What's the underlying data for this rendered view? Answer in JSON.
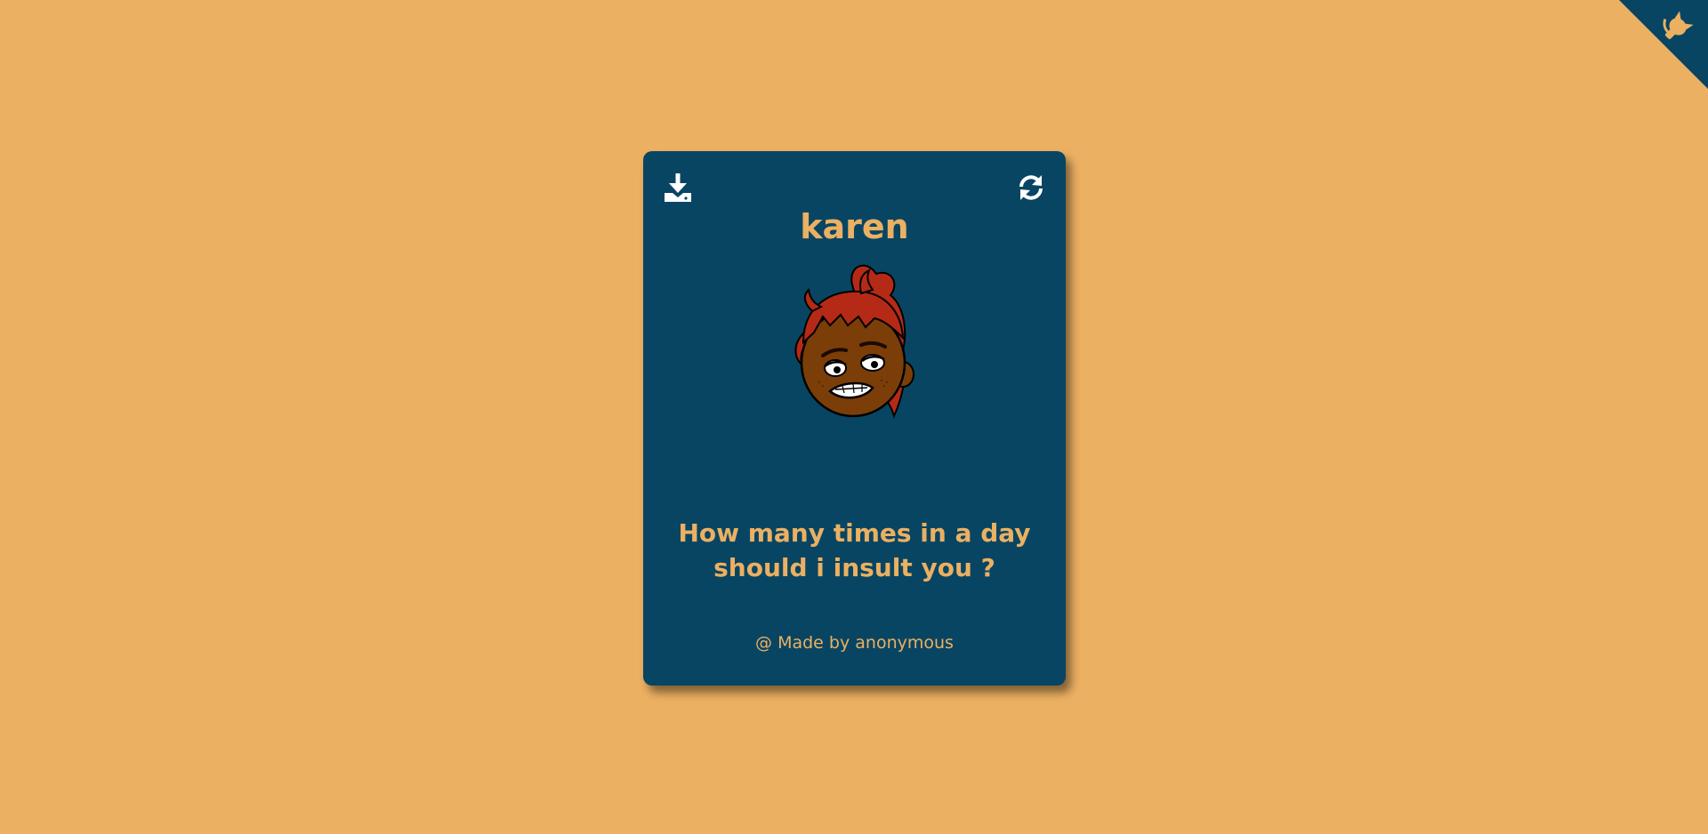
{
  "colors": {
    "background": "#ebb062",
    "card": "#084563",
    "accent": "#ebb062",
    "icon": "#ffffff"
  },
  "github_corner": {
    "icon": "github-octocat-icon"
  },
  "card": {
    "download_icon": "download-icon",
    "refresh_icon": "refresh-icon",
    "title": "karen",
    "avatar_icon": "cartoon-face-avatar",
    "question": "How many times in a day should i insult you ?",
    "footer": "@ Made by anonymous"
  }
}
